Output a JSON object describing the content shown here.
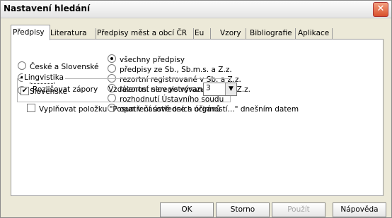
{
  "window": {
    "title": "Nastavení hledání"
  },
  "tabs": [
    {
      "label": "Předpisy",
      "active": true
    },
    {
      "label": "Literatura"
    },
    {
      "label": "Předpisy měst a obcí ČR"
    },
    {
      "label": "Eu"
    },
    {
      "label": "Vzory"
    },
    {
      "label": "Bibliografie"
    },
    {
      "label": "Aplikace"
    }
  ],
  "scope": {
    "options": [
      "České a Slovenské",
      "České",
      "Slovenské"
    ],
    "selected": "České"
  },
  "predpisy": {
    "options": [
      "všechny předpisy",
      "předpisy ze Sb., Sb.m.s. a Z.z.",
      "rezortní registrované v Sb. a Z.z.",
      "rezortní neregistrované v Sb. a Z.z.",
      "rozhodnutí Ústavního soudu",
      "opatření ústředních orgánů"
    ],
    "selected": "všechny předpisy"
  },
  "lingvistika": {
    "group_label": "Lingvistika",
    "rozlisovat_label": "Rozlišovat zápory",
    "rozlisovat_checked": true,
    "vzdalenost_label": "Vzdálenost slov ve výrazu:",
    "vzdalenost_value": "3"
  },
  "vyplnovat": {
    "label": "Vyplňovat položku \"Posun v časové ose s účinností...\" dnešním datem",
    "checked": false
  },
  "buttons": {
    "ok": "OK",
    "storno": "Storno",
    "pouzit": "Použít",
    "napoveda": "Nápověda"
  },
  "icons": {
    "close": "close-icon",
    "check": "check-icon",
    "dropdown": "chevron-down-icon"
  }
}
